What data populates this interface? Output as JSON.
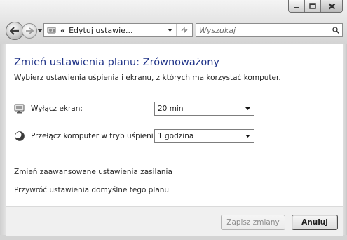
{
  "window": {
    "caption_buttons": {
      "minimize": "minimize-icon",
      "maximize": "maximize-icon",
      "close": "close-icon"
    }
  },
  "nav": {
    "back_icon": "back-arrow-icon",
    "forward_icon": "forward-arrow-icon"
  },
  "address": {
    "chevron": "«",
    "text": "Edytuj ustawie..."
  },
  "search": {
    "placeholder": "Wyszukaj"
  },
  "page": {
    "title": "Zmień ustawienia planu: Zrównoważony",
    "subtitle": "Wybierz ustawienia uśpienia i ekranu, z których ma korzystać komputer."
  },
  "settings": {
    "display": {
      "label": "Wyłącz ekran:",
      "value": "20 min",
      "icon": "monitor-icon"
    },
    "sleep": {
      "label": "Przełącz komputer w tryb uśpienia:",
      "value": "1 godzina",
      "icon": "moon-icon"
    }
  },
  "links": {
    "advanced": "Zmień zaawansowane ustawienia zasilania",
    "restore": "Przywróć ustawienia domyślne tego planu"
  },
  "buttons": {
    "save": "Zapisz zmiany",
    "cancel": "Anuluj"
  }
}
